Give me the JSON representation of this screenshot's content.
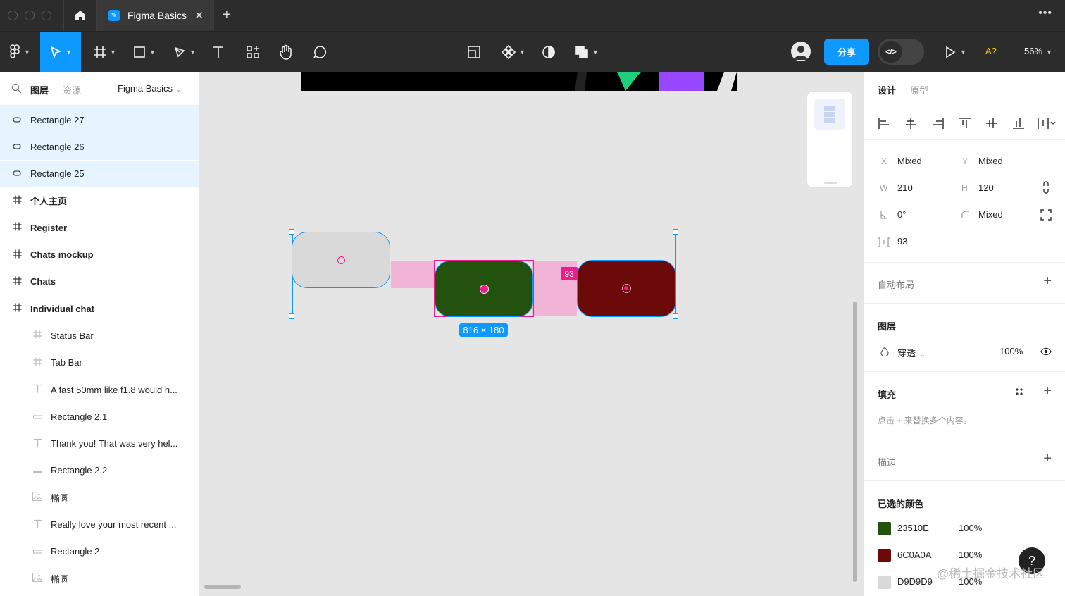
{
  "window": {
    "tab_title": "Figma Basics",
    "tab_close": "✕",
    "new_tab": "+",
    "more": "•••"
  },
  "toolbar": {
    "share_label": "分享",
    "dev_label": "</>",
    "font_warning": "A?",
    "zoom": "56%"
  },
  "left_panel": {
    "tab_layers": "图层",
    "tab_assets": "资源",
    "page_name": "Figma Basics",
    "layers": [
      {
        "name": "Rectangle 27",
        "type": "rect",
        "selected": true,
        "indent": 0
      },
      {
        "name": "Rectangle 26",
        "type": "rect",
        "selected": true,
        "indent": 0
      },
      {
        "name": "Rectangle 25",
        "type": "rect",
        "selected": true,
        "indent": 0
      },
      {
        "name": "个人主页",
        "type": "frame",
        "selected": false,
        "indent": 0
      },
      {
        "name": "Register",
        "type": "frame",
        "selected": false,
        "indent": 0
      },
      {
        "name": "Chats mockup",
        "type": "frame",
        "selected": false,
        "indent": 0
      },
      {
        "name": "Chats",
        "type": "frame",
        "selected": false,
        "indent": 0
      },
      {
        "name": "Individual chat",
        "type": "frame",
        "selected": false,
        "indent": 0
      },
      {
        "name": "Status Bar",
        "type": "frame-child",
        "selected": false,
        "indent": 1
      },
      {
        "name": "Tab Bar",
        "type": "frame-child",
        "selected": false,
        "indent": 1
      },
      {
        "name": "A fast 50mm like f1.8 would h...",
        "type": "text",
        "selected": false,
        "indent": 1
      },
      {
        "name": "Rectangle 2.1",
        "type": "rect-line",
        "selected": false,
        "indent": 1
      },
      {
        "name": "Thank you! That was very hel...",
        "type": "text",
        "selected": false,
        "indent": 1
      },
      {
        "name": "Rectangle 2.2",
        "type": "line",
        "selected": false,
        "indent": 1
      },
      {
        "name": "椭圆",
        "type": "image",
        "selected": false,
        "indent": 1
      },
      {
        "name": "Really love your most recent ...",
        "type": "text",
        "selected": false,
        "indent": 1
      },
      {
        "name": "Rectangle 2",
        "type": "rect-line",
        "selected": false,
        "indent": 1
      },
      {
        "name": "椭圆",
        "type": "image",
        "selected": false,
        "indent": 1
      }
    ]
  },
  "canvas": {
    "size_label": "816 × 180",
    "gap_label": "93"
  },
  "right_panel": {
    "tab_design": "设计",
    "tab_prototype": "原型",
    "x_label": "X",
    "x_value": "Mixed",
    "y_label": "Y",
    "y_value": "Mixed",
    "w_label": "W",
    "w_value": "210",
    "h_label": "H",
    "h_value": "120",
    "rotation_value": "0°",
    "radius_value": "Mixed",
    "spacing_value": "93",
    "auto_layout": "自动布局",
    "layer_title": "图层",
    "blend_mode": "穿透",
    "opacity": "100%",
    "fill_title": "填充",
    "fill_hint": "点击 + 来替换多个内容。",
    "stroke_title": "描边",
    "selected_colors_title": "已选的颜色",
    "colors": [
      {
        "hex": "23510E",
        "color": "#23510E",
        "opacity": "100%"
      },
      {
        "hex": "6C0A0A",
        "color": "#6C0A0A",
        "opacity": "100%"
      },
      {
        "hex": "D9D9D9",
        "color": "#D9D9D9",
        "opacity": "100%"
      }
    ],
    "help": "?",
    "watermark": "@稀土掘金技术社区"
  },
  "colors": {
    "accent": "#0d99ff",
    "spacing_pink": "#e91e8c",
    "rect_gray": "#D9D9D9",
    "rect_green": "#23510E",
    "rect_red": "#6C0A0A"
  }
}
